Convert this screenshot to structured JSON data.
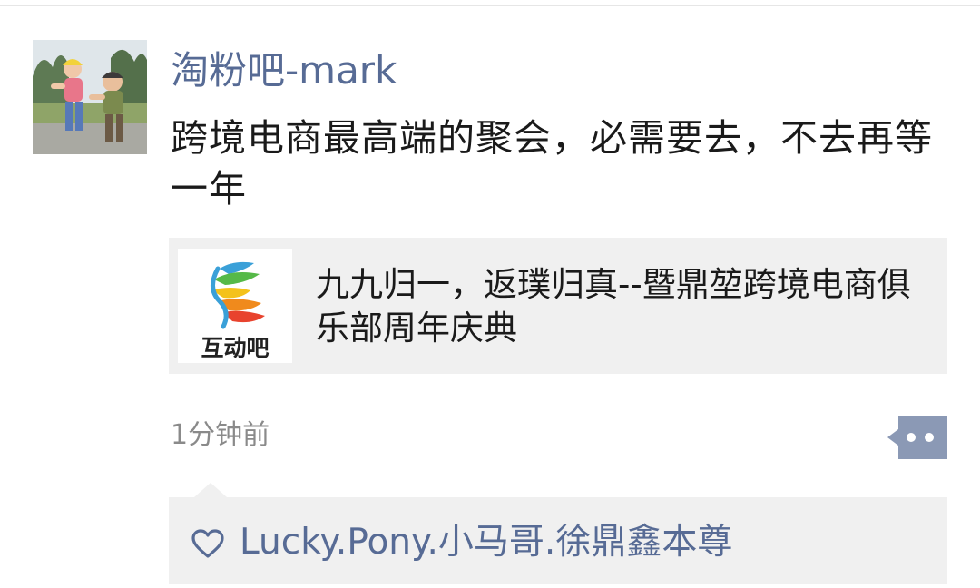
{
  "post": {
    "author": "淘粉吧-mark",
    "text": "跨境电商最高端的聚会，必需要去，不去再等一年",
    "timestamp": "1分钟前"
  },
  "link_card": {
    "logo_caption": "互动吧",
    "title": "九九归一，返璞归真--暨鼎堃跨境电商俱乐部周年庆典"
  },
  "likes": {
    "names": "Lucky.Pony.小马哥.徐鼎鑫本尊"
  },
  "icons": {
    "avatar": "avatar-photo",
    "logo": "hands-logo-icon",
    "more": "more-dots-icon",
    "like": "heart-icon"
  },
  "colors": {
    "name_link": "#576b95",
    "card_bg": "#f0f0f0",
    "timestamp": "#8a8a8a"
  }
}
